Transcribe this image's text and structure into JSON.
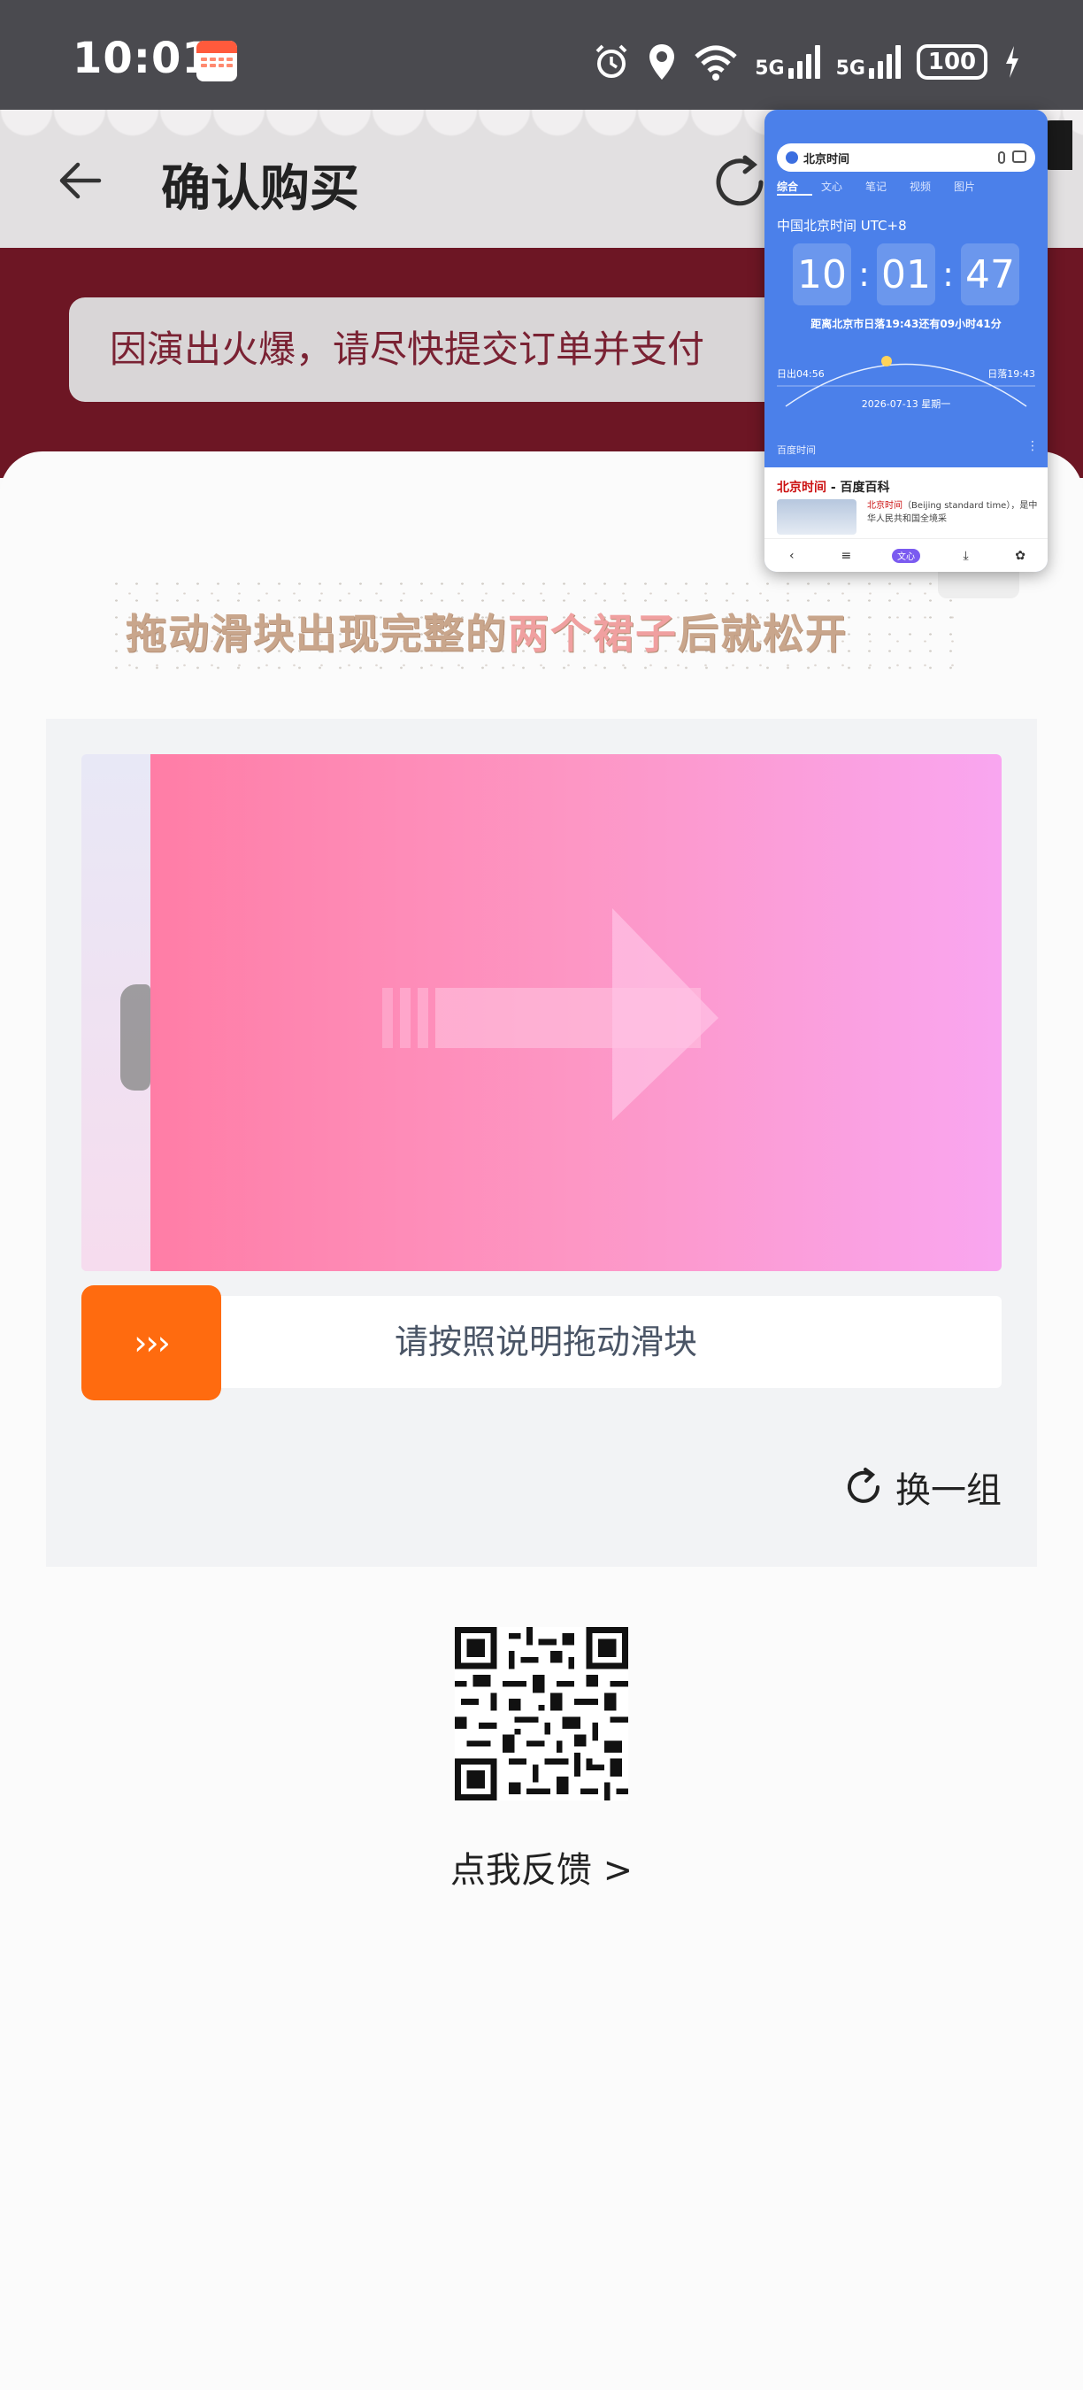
{
  "status_bar": {
    "time": "10:01",
    "network_1": "5G",
    "network_2": "5G",
    "battery": "100"
  },
  "header": {
    "title": "确认购买"
  },
  "notice": {
    "text": "因演出火爆，请尽快提交订单并支付"
  },
  "captcha": {
    "instruction_part1": "拖动滑块出现完整的",
    "instruction_highlight": "两个裙子",
    "instruction_part2": "后就松开",
    "slider_hint": "请按照说明拖动滑块",
    "slider_handle_label": "›››",
    "swap_label": "换一组"
  },
  "feedback": {
    "label": "点我反馈 >"
  },
  "floating_window": {
    "search_query": "北京时间",
    "tabs": [
      "综合",
      "文心",
      "笔记",
      "视频",
      "图片"
    ],
    "clock_title": "中国北京时间 UTC+8",
    "hours": "10",
    "minutes": "01",
    "seconds": "47",
    "colon": ":",
    "sunset_countdown": "距离北京市日落19:43还有09小时41分",
    "sunrise": "日出04:56",
    "sunset": "日落19:43",
    "date": "2026-07-13   星期一",
    "section_label": "百度时间",
    "more": "⋮",
    "card_title_red": "北京时间",
    "card_title_rest": " - 百度百科",
    "card_snippet_red": "北京时间",
    "card_snippet_rest": "（Beijing standard time），是中华人民共和国全境采",
    "nav_ai_label": "文心"
  },
  "colors": {
    "accent_orange": "#ff6b0f",
    "notice_band": "#6d1624",
    "puzzle_pink": "#ff7da6",
    "float_blue": "#4b80ea"
  }
}
